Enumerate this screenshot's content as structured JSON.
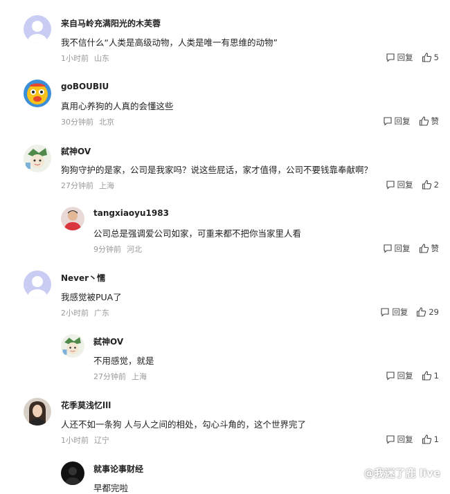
{
  "comments": [
    {
      "name": "来自马岭充满阳光的木芙蓉",
      "text": "我不信什么“人类是高级动物，人类是唯一有思维的动物”",
      "time": "1小时前",
      "location": "山东",
      "reply_label": "回复",
      "like": "5"
    },
    {
      "name": "goBOUBIU",
      "text": "真用心养狗的人真的会懂这些",
      "time": "30分钟前",
      "location": "北京",
      "reply_label": "回复",
      "like": "赞"
    },
    {
      "name": "弑神OV",
      "text": "狗狗守护的是家，公司是我家吗？说这些屁话，家才值得，公司不要钱靠奉献啊？",
      "time": "27分钟前",
      "location": "上海",
      "reply_label": "回复",
      "like": "2"
    },
    {
      "name": "tangxiaoyu1983",
      "text": "公司总是强调爱公司如家，可重来都不把你当家里人看",
      "time": "9分钟前",
      "location": "河北",
      "reply_label": "回复",
      "like": "赞"
    },
    {
      "name": "Never丶懦",
      "text": "我感觉被PUA了",
      "time": "2小时前",
      "location": "广东",
      "reply_label": "回复",
      "like": "29"
    },
    {
      "name": "弑神OV",
      "text": "不用感觉，就是",
      "time": "27分钟前",
      "location": "上海",
      "reply_label": "回复",
      "like": "1"
    },
    {
      "name": "花季莫浅忆lll",
      "text": "人还不如一条狗 人与人之间的相处，勾心斗角的，这个世界完了",
      "time": "1小时前",
      "location": "辽宁",
      "reply_label": "回复",
      "like": "1"
    },
    {
      "name": "就事论事财经",
      "text": "早都完啦"
    }
  ],
  "watermark": "@我迷了鹿 live",
  "icons": {
    "reply": "comment-bubble-icon",
    "like": "thumbs-up-icon"
  },
  "colors": {
    "meta": "#9a9a9a",
    "avatar_default": "#c9cdf3"
  }
}
